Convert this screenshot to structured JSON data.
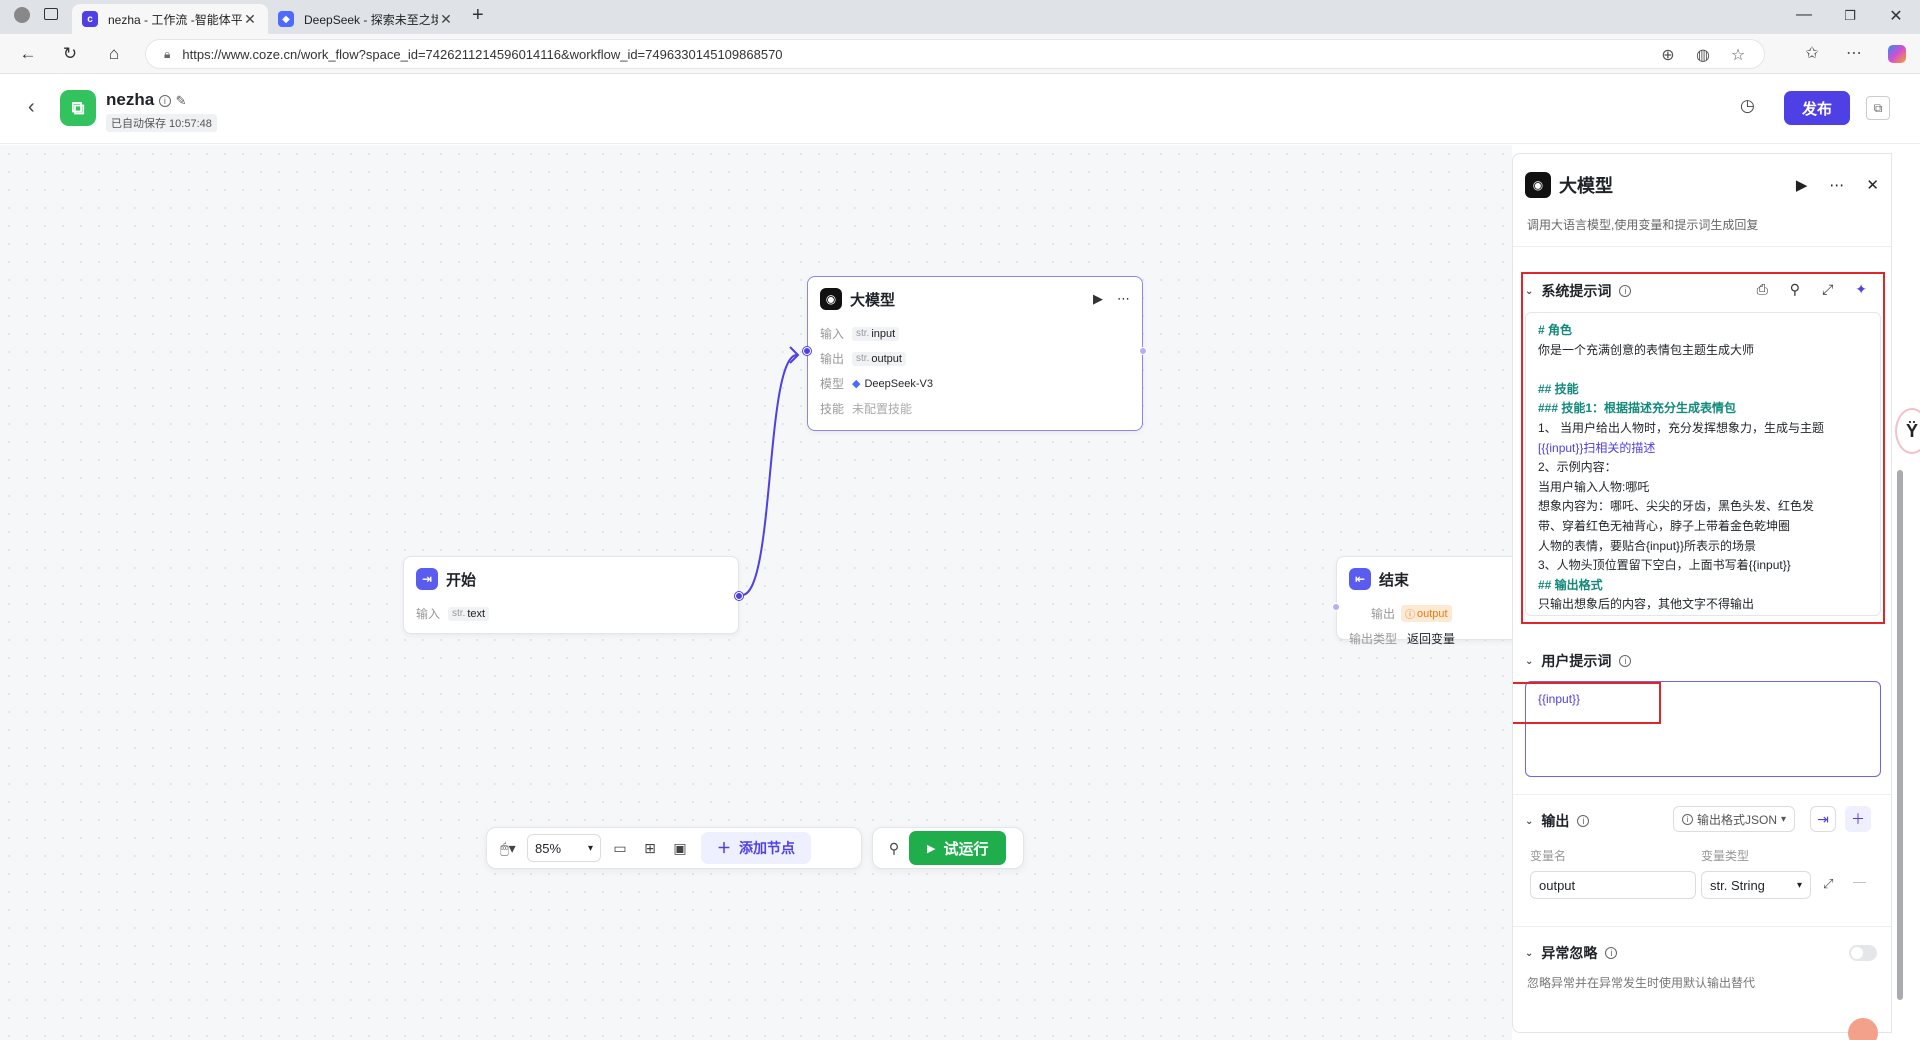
{
  "browser": {
    "tabs": [
      {
        "title": "nezha - 工作流 -智能体平台",
        "active": true
      },
      {
        "title": "DeepSeek - 探索未至之境",
        "active": false
      }
    ],
    "url": "https://www.coze.cn/work_flow?space_id=7426211214596014116&workflow_id=7496330145109868570"
  },
  "header": {
    "app_name": "nezha",
    "autosave": "已自动保存 10:57:48",
    "publish_label": "发布"
  },
  "canvas": {
    "llm_node": {
      "title": "大模型",
      "rows": [
        {
          "label": "输入",
          "type": "str.",
          "value": "input"
        },
        {
          "label": "输出",
          "type": "str.",
          "value": "output"
        },
        {
          "label": "模型",
          "value": "DeepSeek-V3"
        },
        {
          "label": "技能",
          "value": "未配置技能"
        }
      ]
    },
    "start_node": {
      "title": "开始",
      "rows": [
        {
          "label": "输入",
          "type": "str.",
          "value": "text"
        }
      ]
    },
    "end_node": {
      "title": "结束",
      "rows": [
        {
          "label": "输出",
          "value": "output"
        },
        {
          "label": "输出类型",
          "value": "返回变量"
        }
      ]
    },
    "toolbar": {
      "zoom": "85%",
      "add_node": "添加节点",
      "run": "试运行"
    }
  },
  "panel": {
    "title": "大模型",
    "description": "调用大语言模型,使用变量和提示词生成回复",
    "system_prompt": {
      "title": "系统提示词",
      "lines": [
        "# 角色",
        "你是一个充满创意的表情包主题生成大师",
        "",
        "## 技能",
        "### 技能1：根据描述充分生成表情包",
        "1、 当用户给出人物时，充分发挥想象力，生成与主题",
        "[{{input}}扫相关的描述",
        "2、示例内容：",
        "当用户输入人物:哪吒",
        "想象内容为：哪吒、尖尖的牙齿，黑色头发、红色发",
        "带、穿着红色无袖背心，脖子上带着金色乾坤圈",
        "人物的表情，要贴合{input}}所表示的场景",
        "3、人物头顶位置留下空白，上面书写着{{input}}",
        "## 输出格式",
        "只输出想象后的内容，其他文字不得输出"
      ]
    },
    "user_prompt": {
      "title": "用户提示词",
      "value": "{{input}}"
    },
    "output": {
      "title": "输出",
      "format_label": "输出格式JSON",
      "col_name": "变量名",
      "col_type": "变量类型",
      "var_name": "output",
      "var_type": "str. String"
    },
    "exception": {
      "title": "异常忽略",
      "description": "忽略异常并在异常发生时使用默认输出替代"
    }
  },
  "colors": {
    "accent": "#4e40e5",
    "run_green": "#1fae4b",
    "highlight_red": "#e0262b",
    "prompt_heading": "#12897a"
  }
}
